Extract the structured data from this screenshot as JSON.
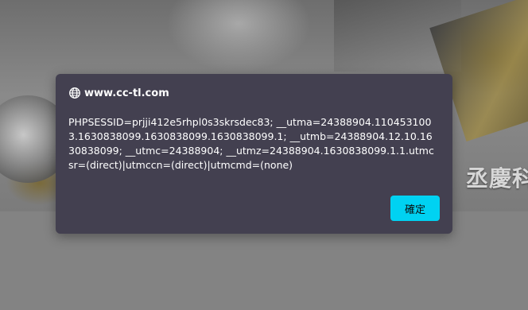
{
  "background": {
    "hero_text": "丞慶科"
  },
  "dialog": {
    "title": "www.cc-tl.com",
    "title_icon": "globe-icon",
    "message": "PHPSESSID=prjji412e5rhpl0s3skrsdec83; __utma=24388904.1104531003.1630838099.1630838099.1630838099.1; __utmb=24388904.12.10.1630838099; __utmc=24388904; __utmz=24388904.1630838099.1.1.utmcsr=(direct)|utmccn=(direct)|utmcmd=(none)",
    "ok_label": "確定"
  },
  "colors": {
    "dialog_bg": "#434050",
    "button_bg": "#00d2f2",
    "page_bg": "#838383"
  }
}
